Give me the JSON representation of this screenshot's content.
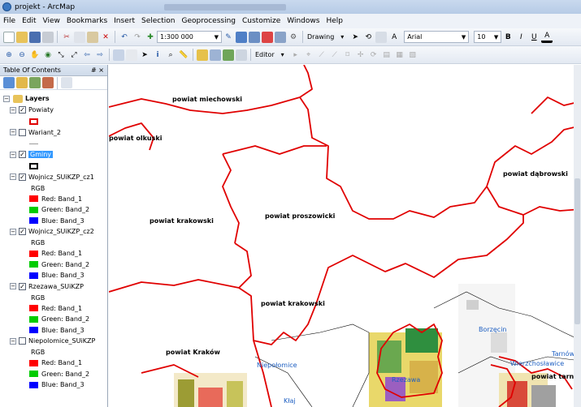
{
  "window": {
    "title": "projekt - ArcMap"
  },
  "menu": [
    "File",
    "Edit",
    "View",
    "Bookmarks",
    "Insert",
    "Selection",
    "Geoprocessing",
    "Customize",
    "Windows",
    "Help"
  ],
  "toolbar": {
    "scale": "1:300 000",
    "drawing": "Drawing",
    "font": "Arial",
    "size": "10",
    "bold": "B",
    "italic": "I",
    "underline": "U",
    "font_color": "A",
    "editor": "Editor"
  },
  "toc": {
    "title": "Table Of Contents",
    "pin": "# ×",
    "root": "Layers",
    "layers": [
      {
        "name": "Powiaty",
        "checked": true,
        "legend": [
          {
            "type": "outline",
            "color": "#e00000",
            "label": ""
          }
        ]
      },
      {
        "name": "Wariant_2",
        "checked": false,
        "legend": [
          {
            "type": "line",
            "color": "#9b9b9b",
            "label": ""
          }
        ]
      },
      {
        "name": "Gminy",
        "checked": true,
        "selected": true,
        "legend": [
          {
            "type": "outline",
            "color": "#000000",
            "label": ""
          }
        ]
      },
      {
        "name": "Wojnicz_SUiKZP_cz1",
        "checked": true,
        "legend": [
          {
            "type": "text",
            "label": "RGB"
          },
          {
            "type": "fill",
            "color": "#ff0000",
            "label": "Red:   Band_1"
          },
          {
            "type": "fill",
            "color": "#00cc00",
            "label": "Green: Band_2"
          },
          {
            "type": "fill",
            "color": "#0000ff",
            "label": "Blue:  Band_3"
          }
        ]
      },
      {
        "name": "Wojnicz_SUiKZP_cz2",
        "checked": true,
        "legend": [
          {
            "type": "text",
            "label": "RGB"
          },
          {
            "type": "fill",
            "color": "#ff0000",
            "label": "Red:   Band_1"
          },
          {
            "type": "fill",
            "color": "#00cc00",
            "label": "Green: Band_2"
          },
          {
            "type": "fill",
            "color": "#0000ff",
            "label": "Blue:  Band_3"
          }
        ]
      },
      {
        "name": "Rzezawa_SUiKZP",
        "checked": true,
        "legend": [
          {
            "type": "text",
            "label": "RGB"
          },
          {
            "type": "fill",
            "color": "#ff0000",
            "label": "Red:   Band_1"
          },
          {
            "type": "fill",
            "color": "#00cc00",
            "label": "Green: Band_2"
          },
          {
            "type": "fill",
            "color": "#0000ff",
            "label": "Blue:  Band_3"
          }
        ]
      },
      {
        "name": "Niepolomice_SUiKZP",
        "checked": false,
        "legend": [
          {
            "type": "text",
            "label": "RGB"
          },
          {
            "type": "fill",
            "color": "#ff0000",
            "label": "Red:   Band_1"
          },
          {
            "type": "fill",
            "color": "#00cc00",
            "label": "Green: Band_2"
          },
          {
            "type": "fill",
            "color": "#0000ff",
            "label": "Blue:  Band_3"
          }
        ]
      }
    ]
  },
  "map": {
    "labels": [
      {
        "text": "powiat miechowski",
        "color": "black"
      },
      {
        "text": "powiat olkuski",
        "color": "black"
      },
      {
        "text": "powiat dąbrowski",
        "color": "black"
      },
      {
        "text": "powiat krakowski",
        "color": "black"
      },
      {
        "text": "powiat proszowicki",
        "color": "black"
      },
      {
        "text": "powiat krakowski",
        "color": "black"
      },
      {
        "text": "powiat Kraków",
        "color": "black"
      },
      {
        "text": "powiat tarnowski",
        "color": "black"
      },
      {
        "text": "Niepołomice",
        "color": "blue"
      },
      {
        "text": "Borzęcin",
        "color": "blue"
      },
      {
        "text": "Wierzchosławice",
        "color": "blue"
      },
      {
        "text": "Tarnów",
        "color": "blue"
      },
      {
        "text": "Kłaj",
        "color": "blue"
      },
      {
        "text": "Rzezawa",
        "color": "blue"
      }
    ],
    "boundary_color": "#e00000"
  }
}
